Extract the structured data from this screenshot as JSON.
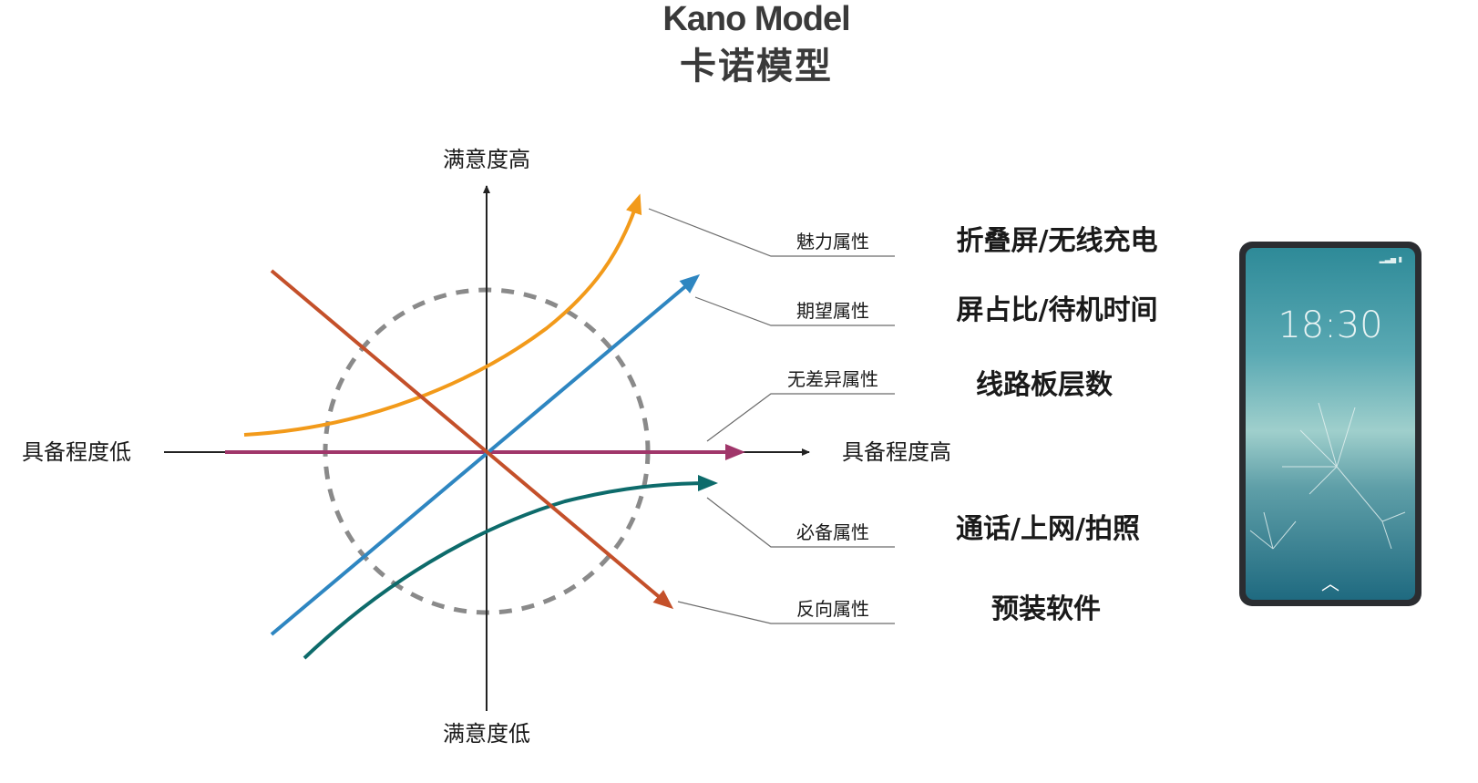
{
  "title": {
    "en": "Kano Model",
    "cn": "卡诺模型"
  },
  "axes": {
    "y_top": "满意度高",
    "y_bottom": "满意度低",
    "x_left": "具备程度低",
    "x_right": "具备程度高"
  },
  "attributes": [
    {
      "label": "魅力属性",
      "example": "折叠屏/无线充电",
      "color": "#f29a1a"
    },
    {
      "label": "期望属性",
      "example": "屏占比/待机时间",
      "color": "#2e86c1"
    },
    {
      "label": "无差异属性",
      "example": "线路板层数",
      "color": "#a0366a"
    },
    {
      "label": "必备属性",
      "example": "通话/上网/拍照",
      "color": "#0d6b6b"
    },
    {
      "label": "反向属性",
      "example": "预装软件",
      "color": "#c4502a"
    }
  ],
  "phone": {
    "clock": "18:30"
  }
}
